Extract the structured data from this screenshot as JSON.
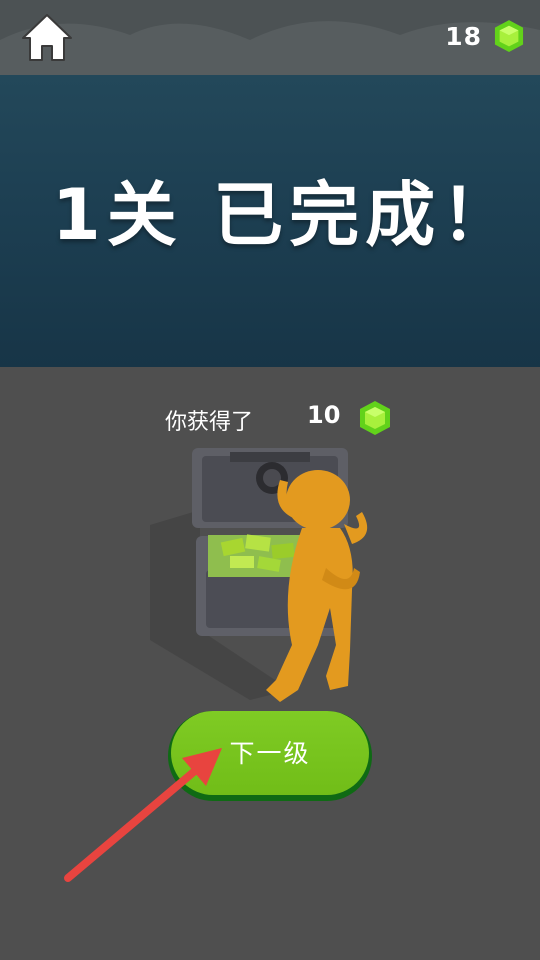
{
  "header": {
    "home_icon": "home-icon",
    "gem_count": "18",
    "gem_icon": "green-gem-icon"
  },
  "banner": {
    "title": "1关 已完成！",
    "color": "#1d3f52"
  },
  "reward": {
    "label": "你获得了",
    "amount": "10",
    "gem_icon": "green-gem-icon"
  },
  "scene": {
    "description_icons": [
      "treasure-chest",
      "orange-stick-figure"
    ]
  },
  "next_button": {
    "label": "下一级",
    "color": "#76c21c"
  },
  "hint": {
    "arrow_icon": "red-pointer-arrow-icon",
    "color": "#e8443f"
  }
}
